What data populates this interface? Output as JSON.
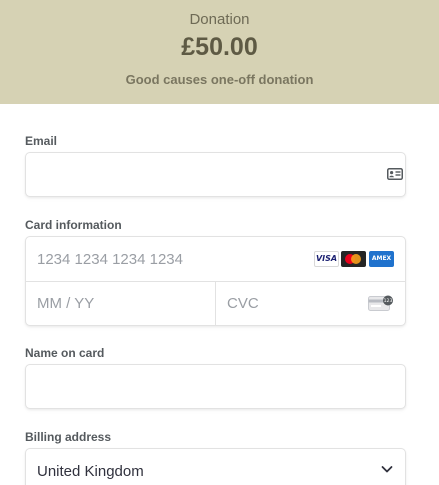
{
  "header": {
    "title": "Donation",
    "amount": "£50.00",
    "subtitle": "Good causes one-off donation"
  },
  "email": {
    "label": "Email",
    "placeholder": "",
    "icon": "contact-card-icon"
  },
  "card": {
    "label": "Card information",
    "number_placeholder": "1234 1234 1234 1234",
    "expiry_placeholder": "MM / YY",
    "cvc_placeholder": "CVC",
    "brands": [
      "VISA",
      "",
      "AMEX"
    ],
    "cvc_icon": "card-cvc-icon"
  },
  "name_on_card": {
    "label": "Name on card",
    "placeholder": ""
  },
  "billing": {
    "label": "Billing address",
    "country": "United Kingdom"
  },
  "colors": {
    "header_bg": "#d6d2b4",
    "header_text": "#5e5a44",
    "visa_blue": "#1a1f71",
    "mastercard_red": "#eb001b",
    "mastercard_orange": "#f79e1b",
    "amex_blue": "#1f72cd"
  }
}
